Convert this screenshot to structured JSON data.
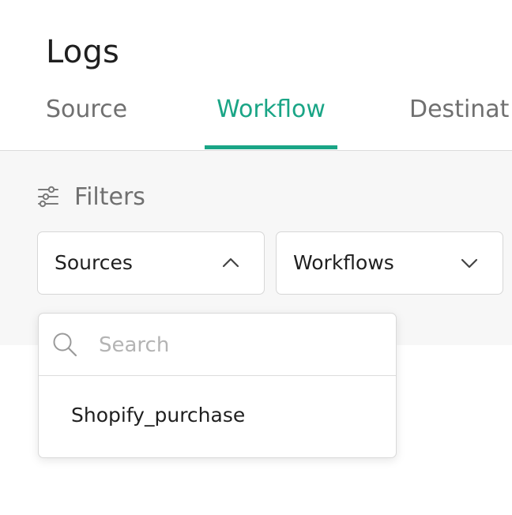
{
  "page": {
    "title": "Logs"
  },
  "tabs": [
    {
      "label": "Source",
      "active": false
    },
    {
      "label": "Workflow",
      "active": true
    },
    {
      "label": "Destinat",
      "active": false
    }
  ],
  "filters": {
    "heading": "Filters",
    "icon": "sliders-icon",
    "dropdowns": [
      {
        "label": "Sources",
        "expanded": true,
        "icon": "chevron-up-icon"
      },
      {
        "label": "Workflows",
        "expanded": false,
        "icon": "chevron-down-icon"
      }
    ]
  },
  "sources_dropdown": {
    "search_placeholder": "Search",
    "search_value": "",
    "search_icon": "search-icon",
    "options": [
      "Shopify_purchase"
    ]
  },
  "colors": {
    "accent": "#1aa586",
    "inactive_text": "#707070",
    "primary_text": "#1f1f1f",
    "filter_background": "#f7f7f7",
    "border": "#d7d7d7"
  }
}
